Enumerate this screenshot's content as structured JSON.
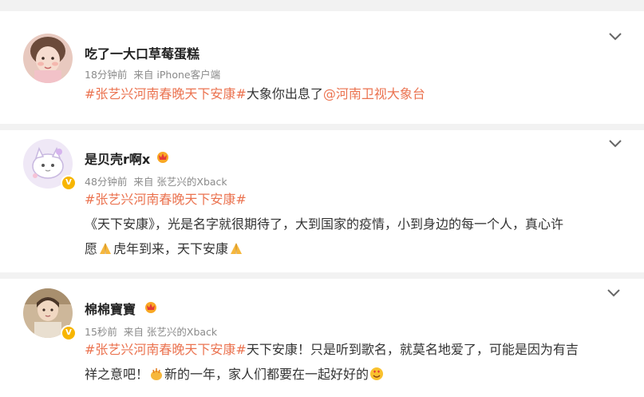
{
  "posts": [
    {
      "username": "吃了一大口草莓蛋糕",
      "time": "18分钟前",
      "source": "来自 iPhone客户端",
      "hashtag": "#张艺兴河南春晚天下安康#",
      "text": "大象你出息了",
      "mention": "@河南卫视大象台",
      "verified": false
    },
    {
      "username": "是贝壳r啊x",
      "time": "48分钟前",
      "source": "来自 张艺兴的Xback",
      "hashtag": "#张艺兴河南春晚天下安康#",
      "text_line1": "《天下安康》，光是名字就很期待了，大到国家的疫情，小到身边的每一个人，真心许",
      "text_line2a": "愿",
      "text_line2b": "虎年到来，天下安康",
      "verified": true,
      "badge": "V"
    },
    {
      "username": "棉棉寶寶",
      "time": "15秒前",
      "source": "来自 张艺兴的Xback",
      "hashtag": "#张艺兴河南春晚天下安康#",
      "text_line1": "天下安康！只是听到歌名，就莫名地爱了，可能是因为有吉",
      "text_line2a": "祥之意吧！",
      "text_line2b": "新的一年，家人们都要在一起好好的",
      "verified": true,
      "badge": "V"
    }
  ],
  "colors": {
    "tag": "#eb7350",
    "meta": "#8a8a8a",
    "badge": "#f7b500",
    "separator": "#f2f2f2"
  },
  "icons": [
    "chevron-down-icon",
    "crown-vip-icon",
    "pray-emoji",
    "clap-emoji",
    "heart-eyes-emoji"
  ]
}
